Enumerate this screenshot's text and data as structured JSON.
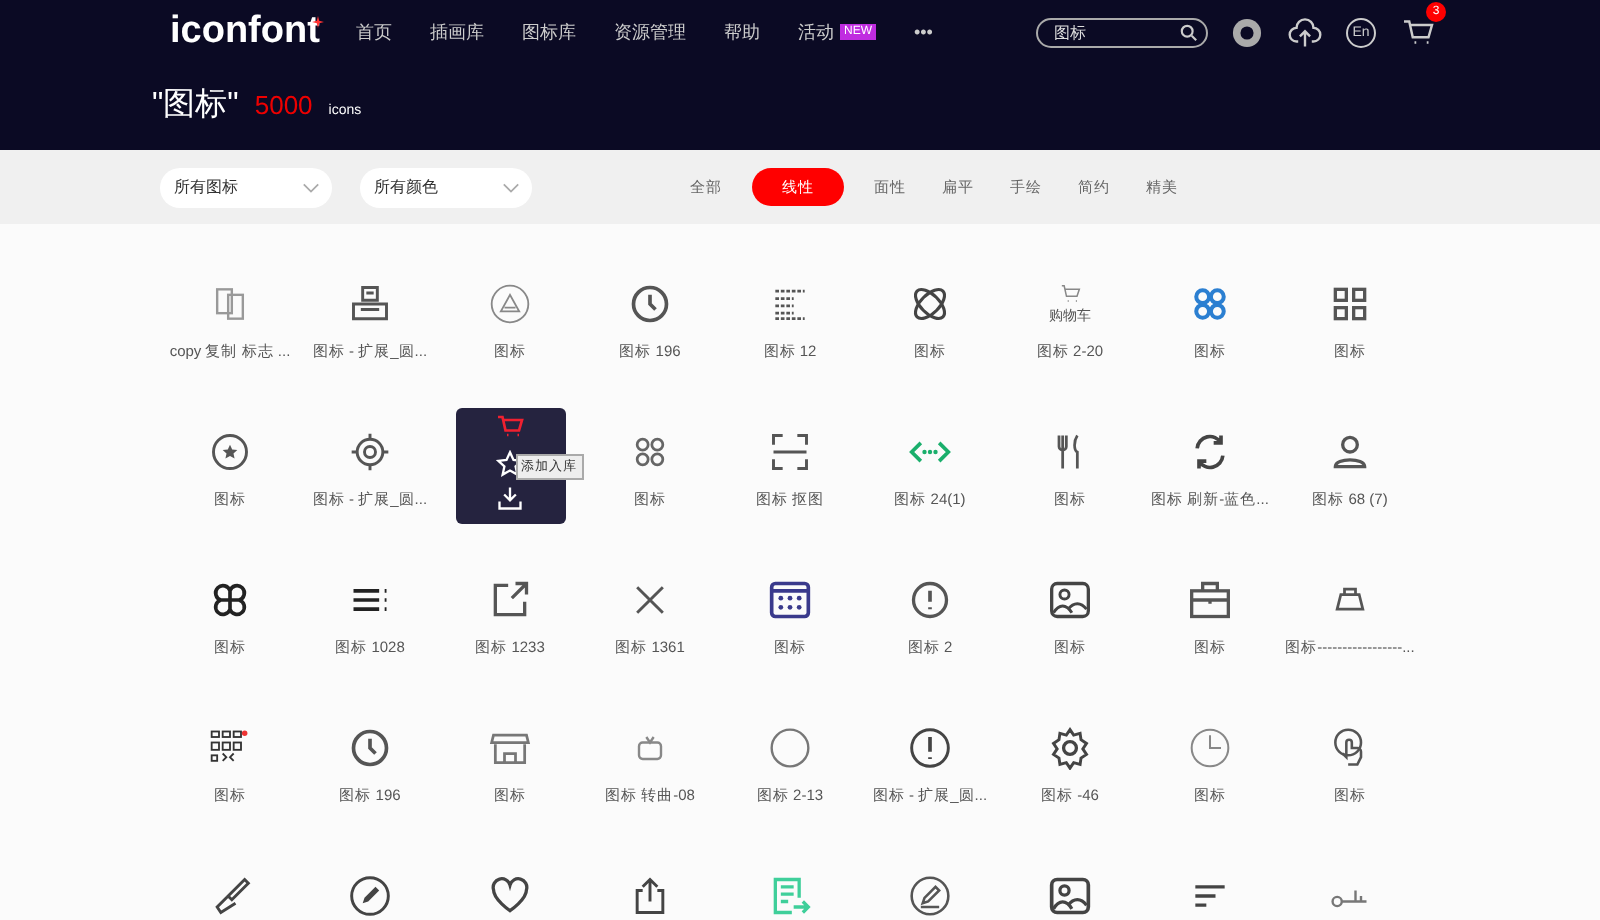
{
  "header": {
    "logo": "iconfont",
    "nav": [
      {
        "label": "首页"
      },
      {
        "label": "插画库"
      },
      {
        "label": "图标库"
      },
      {
        "label": "资源管理"
      },
      {
        "label": "帮助"
      },
      {
        "label": "活动",
        "badge": "NEW"
      },
      {
        "label": "•••"
      }
    ],
    "search": {
      "value": "图标"
    },
    "language": "En",
    "cart_count": "3"
  },
  "title": {
    "query": "\"图标\"",
    "count": "5000",
    "unit": "icons"
  },
  "filters": {
    "dropdowns": [
      "所有图标",
      "所有颜色"
    ],
    "styles": [
      {
        "label": "全部",
        "selected": false
      },
      {
        "label": "线性",
        "selected": true
      },
      {
        "label": "面性",
        "selected": false
      },
      {
        "label": "扁平",
        "selected": false
      },
      {
        "label": "手绘",
        "selected": false
      },
      {
        "label": "简约",
        "selected": false
      },
      {
        "label": "精美",
        "selected": false
      }
    ]
  },
  "icons": [
    {
      "label": "copy 复制 标志 ...",
      "hovered": false
    },
    {
      "label": "图标 - 扩展_圆...",
      "hovered": false
    },
    {
      "label": "图标",
      "hovered": false
    },
    {
      "label": "图标 196",
      "hovered": false
    },
    {
      "label": "图标 12",
      "hovered": false
    },
    {
      "label": "图标",
      "hovered": false
    },
    {
      "label": "图标 2-20",
      "hovered": false,
      "icon_text": "购物车"
    },
    {
      "label": "图标",
      "hovered": false
    },
    {
      "label": "图标",
      "hovered": false
    },
    {
      "label": "图标",
      "hovered": false
    },
    {
      "label": "图标 - 扩展_圆...",
      "hovered": false
    },
    {
      "hovered": true,
      "tooltip": "添加入库"
    },
    {
      "label": "图标",
      "hovered": false
    },
    {
      "label": "图标 抠图",
      "hovered": false
    },
    {
      "label": "图标 24(1)",
      "hovered": false
    },
    {
      "label": "图标",
      "hovered": false
    },
    {
      "label": "图标 刷新-蓝色...",
      "hovered": false
    },
    {
      "label": "图标 68 (7)",
      "hovered": false
    },
    {
      "label": "图标",
      "hovered": false
    },
    {
      "label": "图标 1028",
      "hovered": false
    },
    {
      "label": "图标 1233",
      "hovered": false
    },
    {
      "label": "图标 1361",
      "hovered": false
    },
    {
      "label": "图标",
      "hovered": false
    },
    {
      "label": "图标 2",
      "hovered": false
    },
    {
      "label": "图标",
      "hovered": false
    },
    {
      "label": "图标",
      "hovered": false
    },
    {
      "label": "图标-----------------...",
      "hovered": false
    },
    {
      "label": "图标",
      "hovered": false
    },
    {
      "label": "图标 196",
      "hovered": false
    },
    {
      "label": "图标",
      "hovered": false
    },
    {
      "label": "图标 转曲-08",
      "hovered": false
    },
    {
      "label": "图标 2-13",
      "hovered": false
    },
    {
      "label": "图标 - 扩展_圆...",
      "hovered": false
    },
    {
      "label": "图标 -46",
      "hovered": false
    },
    {
      "label": "图标",
      "hovered": false
    },
    {
      "label": "图标",
      "hovered": false
    },
    {
      "hovered": false
    },
    {
      "hovered": false
    },
    {
      "hovered": false
    },
    {
      "hovered": false
    },
    {
      "hovered": false
    },
    {
      "hovered": false
    },
    {
      "hovered": false
    },
    {
      "hovered": false
    },
    {
      "hovered": false
    }
  ]
}
